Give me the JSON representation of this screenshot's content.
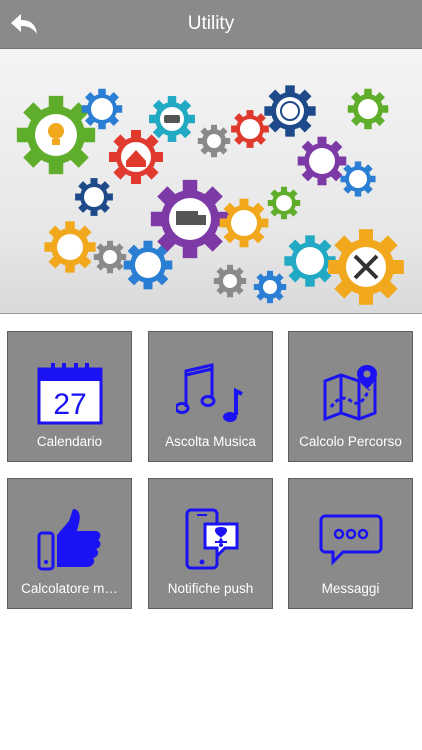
{
  "header": {
    "title": "Utility"
  },
  "colors": {
    "header_bg": "#8a8a8a",
    "tile_bg": "#8a8a8a",
    "icon_blue": "#1a12f2"
  },
  "banner": {
    "icon_name": "colorful-gears-utility-icon"
  },
  "tiles": [
    {
      "label": "Calendario",
      "icon": "calendar-icon",
      "icon_text": "27"
    },
    {
      "label": "Ascolta Musica",
      "icon": "music-notes-icon"
    },
    {
      "label": "Calcolo Percorso",
      "icon": "map-route-icon"
    },
    {
      "label": "Calcolatore m…",
      "icon": "thumbs-up-icon"
    },
    {
      "label": "Notifiche push",
      "icon": "push-notification-icon"
    },
    {
      "label": "Messaggi",
      "icon": "chat-bubble-icon"
    }
  ]
}
